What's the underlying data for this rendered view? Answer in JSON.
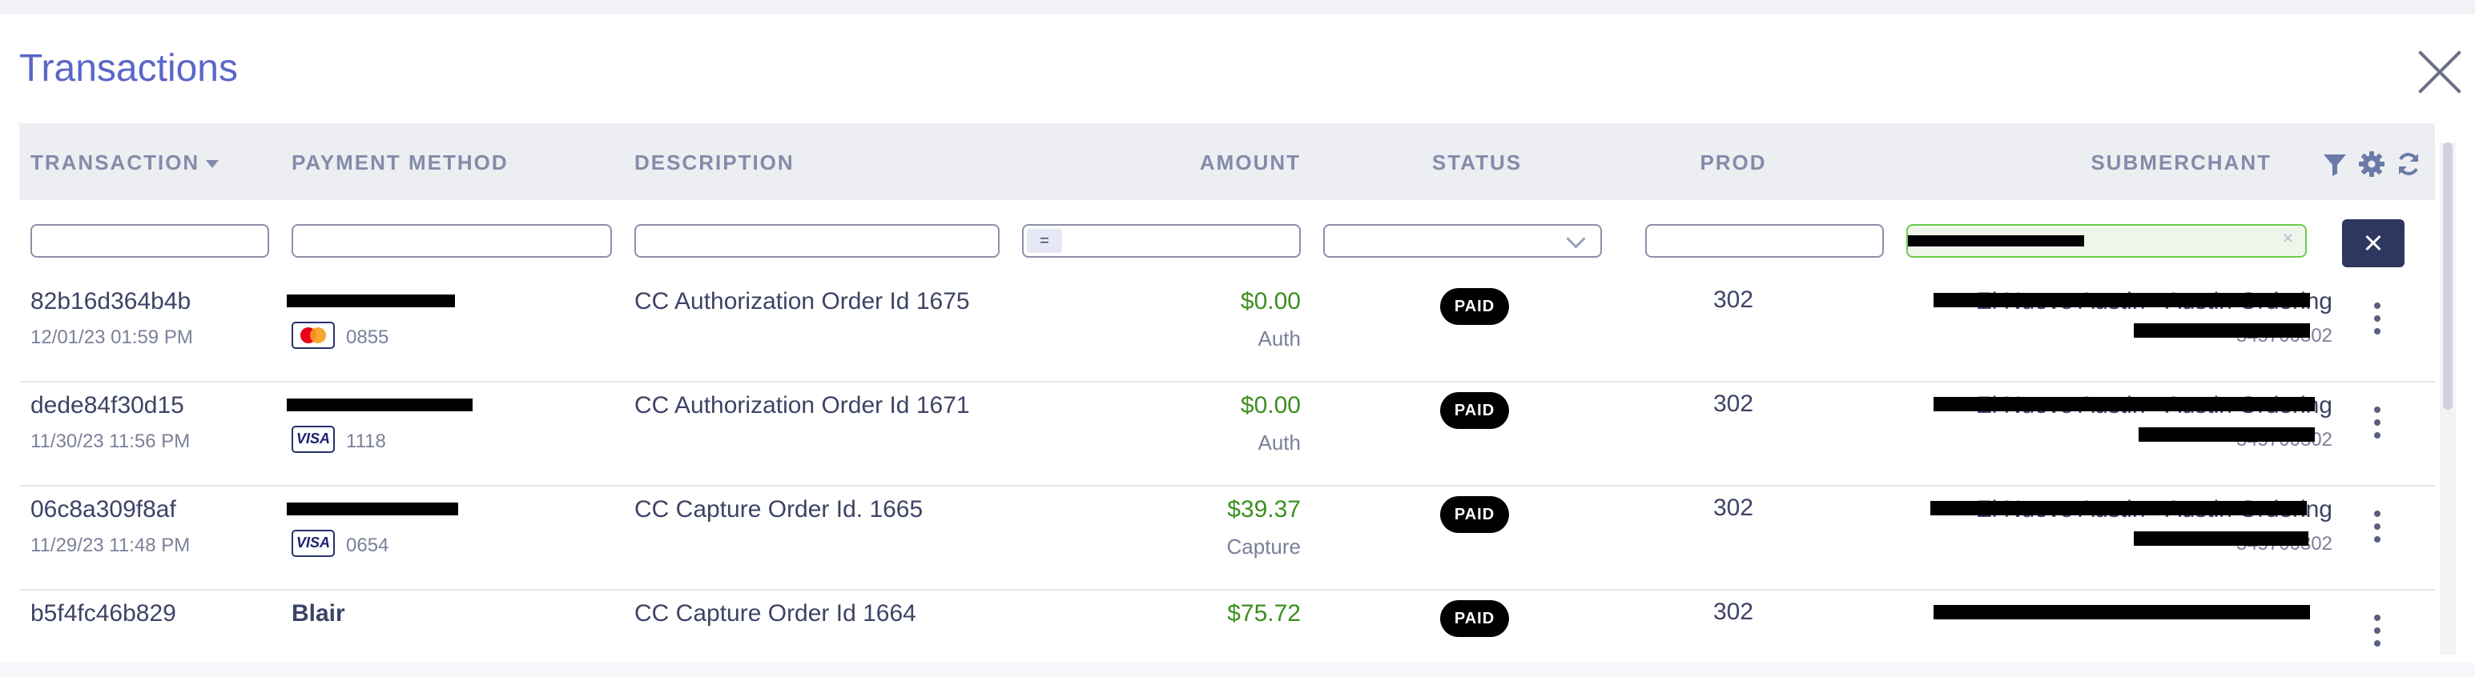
{
  "title": "Transactions",
  "colors": {
    "title": "#5a67c8",
    "amount": "#3b8f1e",
    "status_bg": "#000000",
    "clear_button": "#2f365f",
    "active_filter_border": "#6bcc4c"
  },
  "columns": [
    "TRANSACTION",
    "PAYMENT METHOD",
    "DESCRIPTION",
    "AMOUNT",
    "STATUS",
    "PROD",
    "SUBMERCHANT"
  ],
  "header_icons": [
    "filter-icon",
    "gear-icon",
    "refresh-icon"
  ],
  "filters": {
    "amount_operator": "=",
    "submerchant_value": "",
    "status_value": ""
  },
  "rows": [
    {
      "id": "82b16d364b4b",
      "date": "12/01/23 01:59 PM",
      "card_brand": "mastercard",
      "card_last4": "0855",
      "description": "CC Authorization Order Id 1675",
      "amount": "$0.00",
      "amount_type": "Auth",
      "status": "PAID",
      "prod": "302",
      "submerchant": "El Nuevo Austin - Austin Ordering",
      "submerchant_id": "345700302"
    },
    {
      "id": "dede84f30d15",
      "date": "11/30/23 11:56 PM",
      "card_brand": "visa",
      "card_last4": "1118",
      "description": "CC Authorization Order Id 1671",
      "amount": "$0.00",
      "amount_type": "Auth",
      "status": "PAID",
      "prod": "302",
      "submerchant": "El Nuevo Austin - Austin Ordering",
      "submerchant_id": "345700302"
    },
    {
      "id": "06c8a309f8af",
      "date": "11/29/23 11:48 PM",
      "card_brand": "visa",
      "card_last4": "0654",
      "description": "CC Capture Order Id. 1665",
      "amount": "$39.37",
      "amount_type": "Capture",
      "status": "PAID",
      "prod": "302",
      "submerchant": "El Nuevo Austin - Austin Ordering",
      "submerchant_id": "345700302"
    },
    {
      "id": "b5f4fc46b829",
      "payer": "Blair",
      "description": "CC Capture Order Id 1664",
      "amount": "$75.72",
      "status": "PAID",
      "prod": "302"
    }
  ]
}
